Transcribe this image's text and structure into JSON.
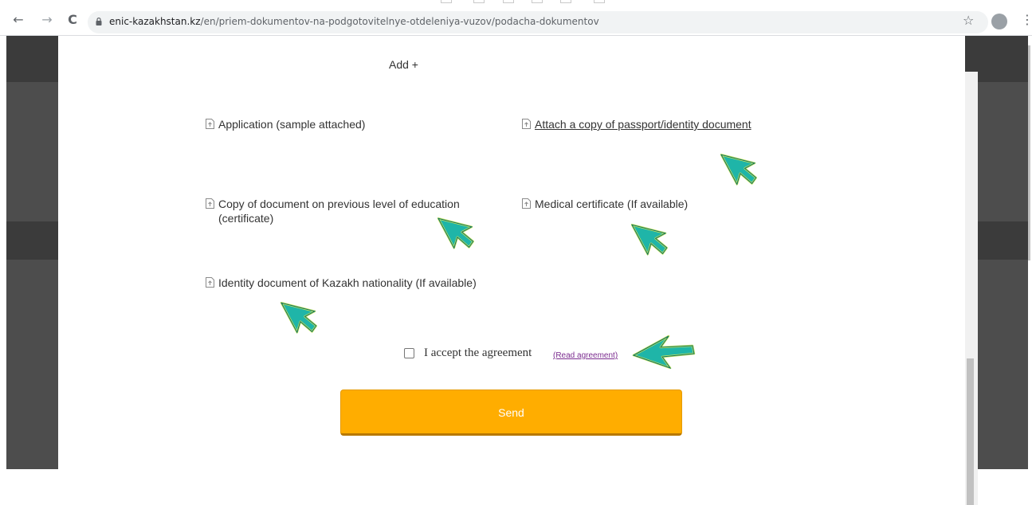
{
  "browser": {
    "url_host": "enic-kazakhstan.kz",
    "url_path": "/en/priem-dokumentov-na-podgotovitelnye-otdeleniya-vuzov/podacha-dokumentov",
    "back_icon": "←",
    "forward_icon": "→",
    "reload_icon": "C",
    "star_icon": "☆",
    "menu_icon": "⋮"
  },
  "form": {
    "add_label": "Add +",
    "documents": [
      {
        "label": "Application (sample attached)",
        "is_link": false
      },
      {
        "label": "Attach a copy of passport/identity document",
        "is_link": true
      },
      {
        "label": "Copy of document on previous level of education (certificate)",
        "is_link": false
      },
      {
        "label": "Medical certificate (If available)",
        "is_link": false
      },
      {
        "label": "Identity document of Kazakh nationality (If available)",
        "is_link": false
      }
    ],
    "agreement": {
      "text": "I accept the agreement",
      "link_text": "(Read agreement)",
      "checked": false
    },
    "send_label": "Send"
  },
  "colors": {
    "send_button": "#ffad00",
    "agreement_link": "#7b2c8f",
    "cursor_fill": "#1fb5a8",
    "cursor_glow": "#c8e85a"
  }
}
